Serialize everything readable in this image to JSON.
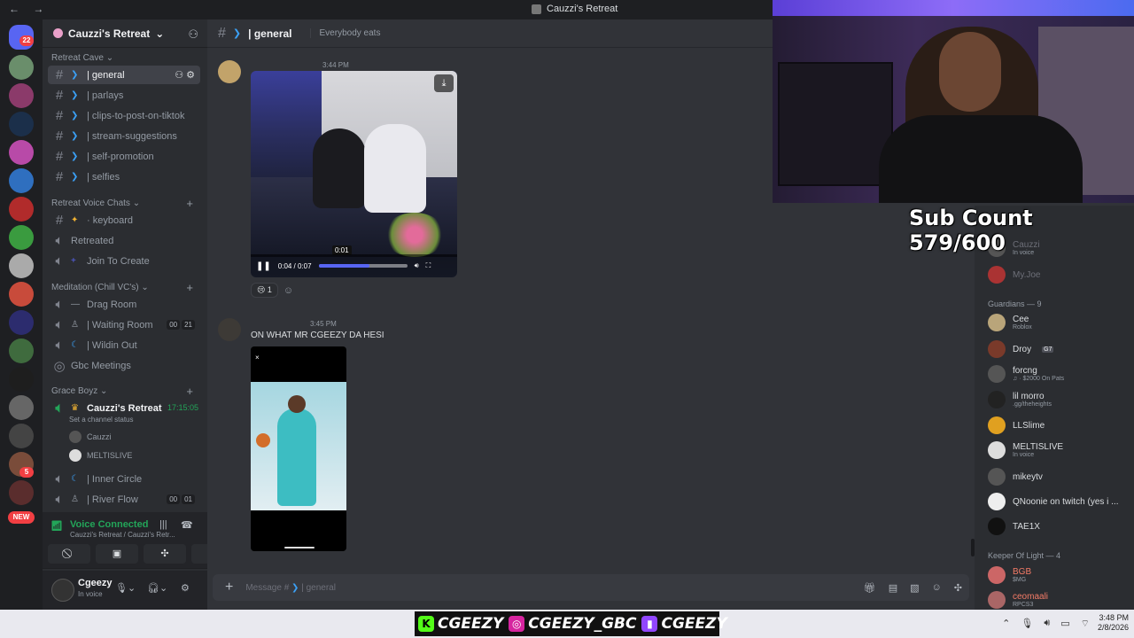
{
  "window": {
    "title": "Cauzzi's Retreat",
    "nav": "← →"
  },
  "rail": {
    "dm_badge": "22",
    "new_label": "NEW",
    "badges": [
      "5"
    ]
  },
  "server": {
    "name": "Cauzzi's Retreat"
  },
  "categories": [
    {
      "name": "Retreat Cave",
      "channels": [
        "| general",
        "| parlays",
        "| clips-to-post-on-tiktok",
        "| stream-suggestions",
        "| self-promotion",
        "| selfies"
      ]
    },
    {
      "name": "Retreat Voice Chats",
      "channels": [
        "· keyboard",
        "Retreated",
        "Join To Create"
      ]
    },
    {
      "name": "Meditation (Chill VC's)",
      "channels": [
        "Drag Room",
        "| Waiting Room",
        "| Wildin Out",
        "Gbc Meetings"
      ]
    },
    {
      "name": "Grace Boyz",
      "channels": [
        "Cauzzi's Retreat",
        "| Inner Circle",
        "| River Flow"
      ]
    }
  ],
  "voice_counts": {
    "waiting_room": [
      "00",
      "21"
    ],
    "river_flow": [
      "00",
      "01"
    ]
  },
  "voice_channel": {
    "timer": "17:15:05",
    "status": "Set a channel status",
    "users": [
      "Cauzzi",
      "MELTISLIVE"
    ]
  },
  "voice_panel": {
    "status": "Voice Connected",
    "sub": "Cauzzi's Retreat / Cauzzi's Retr..."
  },
  "user": {
    "name": "Cgeezy",
    "status": "In voice"
  },
  "chat": {
    "channel": "| general",
    "topic": "Everybody eats",
    "msg1": {
      "time": "3:44 PM",
      "video_time": "0:04 / 0:07",
      "tooltip": "0:01",
      "progress": 0.57,
      "reaction_count": "1"
    },
    "msg2": {
      "time": "3:45 PM",
      "text": "ON WHAT MR CGEEZY DA HESI"
    },
    "composer_placeholder": "Message #",
    "composer_channel": "| general"
  },
  "members": {
    "top": [
      {
        "name": "Cauzzi",
        "status": "In voice"
      },
      {
        "name": "My.Joe",
        "status": ""
      }
    ],
    "guardians_header": "Guardians — 9",
    "guardians": [
      {
        "name": "Cee",
        "status": "Roblox"
      },
      {
        "name": "Droy",
        "status": "",
        "tag": "G7"
      },
      {
        "name": "forcng",
        "status": "♫ · $2000 On Pats"
      },
      {
        "name": "lil morro",
        "status": ".gg/theheights"
      },
      {
        "name": "LLSlime",
        "status": ""
      },
      {
        "name": "MELTISLIVE",
        "status": "In voice"
      },
      {
        "name": "mikeytv",
        "status": ""
      },
      {
        "name": "QNoonie on twitch (yes i ...",
        "status": ""
      },
      {
        "name": "TAE1X",
        "status": ""
      }
    ],
    "keeper_header": "Keeper Of Light — 4",
    "keepers": [
      {
        "name": "BGB",
        "status": "$MG"
      },
      {
        "name": "ceomaali",
        "status": "RPCS3"
      }
    ]
  },
  "overlay": {
    "sub_count": "Sub Count 579/600"
  },
  "socials": [
    "CGEEZY",
    "CGEEZY_GBC",
    "CGEEZY"
  ],
  "clock": {
    "time": "3:48 PM",
    "date": "2/8/2026"
  }
}
